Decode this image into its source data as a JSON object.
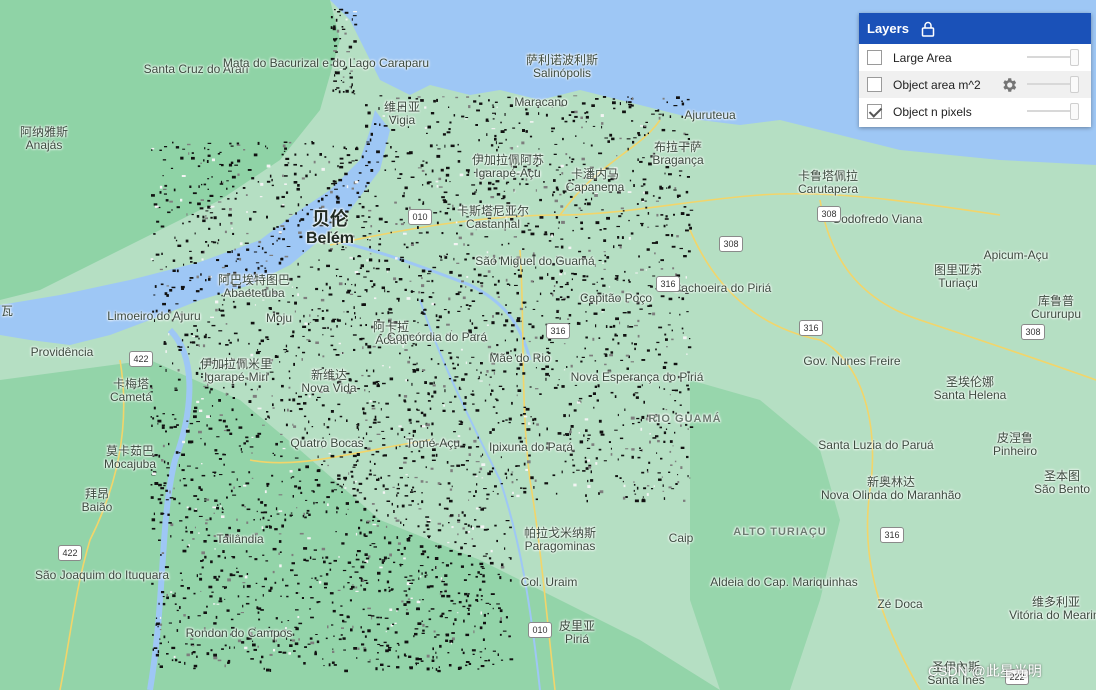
{
  "layers_panel": {
    "title": "Layers",
    "layers": [
      {
        "label": "Large Area",
        "checked": false,
        "opacity": 1.0,
        "has_settings": false
      },
      {
        "label": "Object area m^2",
        "checked": false,
        "opacity": 1.0,
        "has_settings": true
      },
      {
        "label": "Object n pixels",
        "checked": true,
        "opacity": 1.0,
        "has_settings": false
      }
    ]
  },
  "places": [
    {
      "zh": "",
      "pt": "Santa Cruz do Arari"
    },
    {
      "zh": "",
      "pt": "Mata do Bacurizal e do Lago Caraparu"
    },
    {
      "zh": "萨利诺波利斯",
      "pt": "Salinópolis"
    },
    {
      "zh": "维日亚",
      "pt": "Vigia"
    },
    {
      "zh": "",
      "pt": "Maracano"
    },
    {
      "zh": "",
      "pt": "Ajuruteua"
    },
    {
      "zh": "阿纳雅斯",
      "pt": "Anajás"
    },
    {
      "zh": "伊加拉佩阿苏",
      "pt": "Igarapé-Açu"
    },
    {
      "zh": "布拉干萨",
      "pt": "Bragança"
    },
    {
      "zh": "卡潘内马",
      "pt": "Capanema"
    },
    {
      "zh": "卡鲁塔佩拉",
      "pt": "Carutapera"
    },
    {
      "zh": "贝伦",
      "pt": "Belém"
    },
    {
      "zh": "卡斯塔尼亚尔",
      "pt": "Castanhal"
    },
    {
      "zh": "",
      "pt": "Godofredo Viana"
    },
    {
      "zh": "",
      "pt": "São Miguel do Guamá"
    },
    {
      "zh": "",
      "pt": "Apicum-Açu"
    },
    {
      "zh": "阿巴埃特图巴",
      "pt": "Abaetetuba"
    },
    {
      "zh": "",
      "pt": "Cachoeira do Piriá"
    },
    {
      "zh": "图里亚苏",
      "pt": "Turiaçu"
    },
    {
      "zh": "",
      "pt": "Capitão Poço"
    },
    {
      "zh": "库鲁普",
      "pt": "Cururupu"
    },
    {
      "zh": "",
      "pt": "Limoeiro do Ajuru"
    },
    {
      "zh": "",
      "pt": "Moju"
    },
    {
      "zh": "阿卡拉",
      "pt": "Acará"
    },
    {
      "zh": "",
      "pt": "Concórdia do Pará"
    },
    {
      "zh": "",
      "pt": "Providência"
    },
    {
      "zh": "",
      "pt": "Mãe do Rio"
    },
    {
      "zh": "",
      "pt": "Gov. Nunes Freire"
    },
    {
      "zh": "伊加拉佩米里",
      "pt": "Igarapé-Miri"
    },
    {
      "zh": "新维达",
      "pt": "Nova Vida"
    },
    {
      "zh": "卡梅塔",
      "pt": "Cametá"
    },
    {
      "zh": "",
      "pt": "Nova Esperança do Piriá"
    },
    {
      "zh": "圣埃伦娜",
      "pt": "Santa Helena"
    },
    {
      "zh": "",
      "pt": "Quatro Bocas"
    },
    {
      "zh": "",
      "pt": "Tomé-Açu"
    },
    {
      "zh": "",
      "pt": "Santa Luzia do Paruá"
    },
    {
      "zh": "皮涅鲁",
      "pt": "Pinheiro"
    },
    {
      "zh": "莫卡茹巴",
      "pt": "Mocajuba"
    },
    {
      "zh": "",
      "pt": "Ipixuna do Pará"
    },
    {
      "zh": "新奥林达",
      "pt": "Nova Olinda do Maranhão"
    },
    {
      "zh": "圣本图",
      "pt": "São Bento"
    },
    {
      "zh": "拜昂",
      "pt": "Baião"
    },
    {
      "zh": "",
      "pt": "ALTO TURIAÇU"
    },
    {
      "zh": "",
      "pt": "Tailândia"
    },
    {
      "zh": "帕拉戈米纳斯",
      "pt": "Paragominas"
    },
    {
      "zh": "",
      "pt": "Caip"
    },
    {
      "zh": "",
      "pt": "São Joaquim do Ituquara"
    },
    {
      "zh": "",
      "pt": "Col. Uraim"
    },
    {
      "zh": "",
      "pt": "Aldeia do Cap. Mariquinhas"
    },
    {
      "zh": "",
      "pt": "Zé Doca"
    },
    {
      "zh": "维多利亚",
      "pt": "Vitória do Mearim"
    },
    {
      "zh": "皮里亚",
      "pt": "Piriá"
    },
    {
      "zh": "",
      "pt": "Rondon do Campos"
    },
    {
      "zh": "圣伊內斯",
      "pt": "Santa Inês"
    },
    {
      "zh": "",
      "pt": "瓦"
    },
    {
      "zh": "",
      "pt": "RIO GUAMÁ"
    }
  ],
  "road_shields": [
    "308",
    "308",
    "308",
    "316",
    "316",
    "422",
    "422",
    "010",
    "010",
    "316",
    "222",
    "316"
  ],
  "watermark": "CSDN @此星光明",
  "colors": {
    "ocean": "#9ec7f5",
    "land": "#b7e0c6",
    "forest": "#8fd1a6",
    "panel_header": "#1a51b8",
    "detected_pixels": "#111111"
  }
}
